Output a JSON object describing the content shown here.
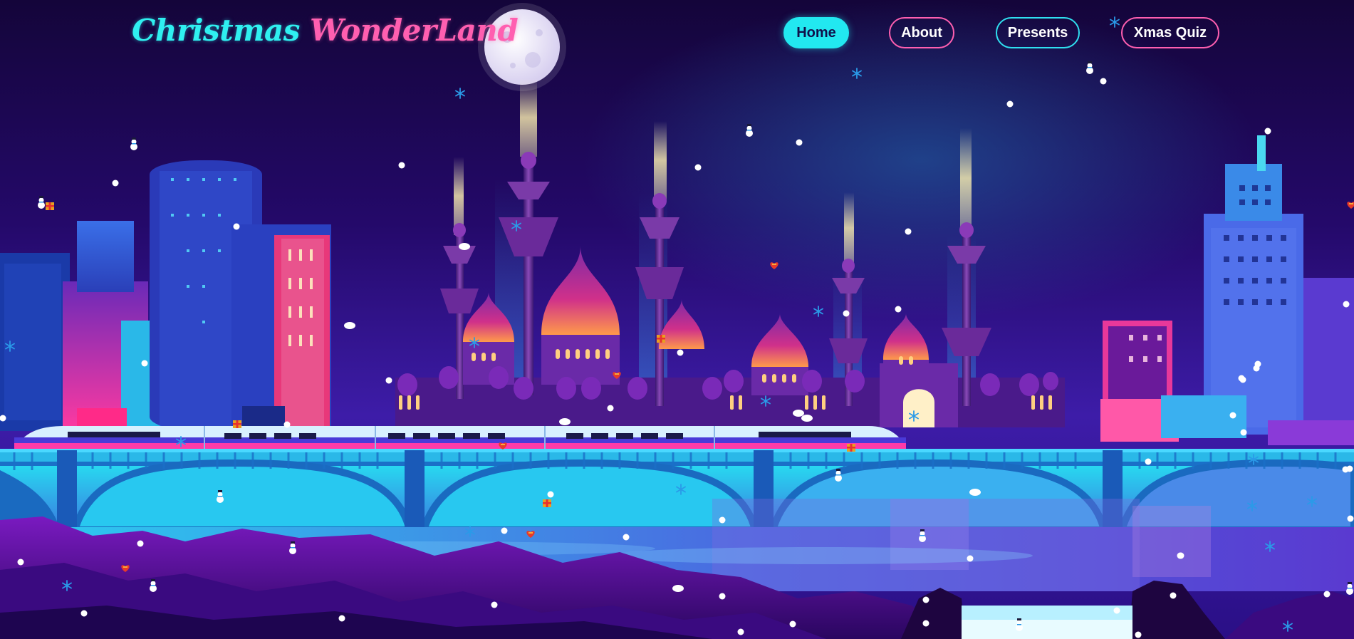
{
  "site": {
    "logo_part1": "Christmas",
    "logo_part2": "WonderLand"
  },
  "nav": {
    "home": "Home",
    "about": "About",
    "presents": "Presents",
    "quiz": "Xmas Quiz"
  },
  "colors": {
    "accent_cyan": "#22e8f0",
    "accent_pink": "#ff5fb0",
    "sky_dark": "#17063d",
    "sky_mid": "#3a1a8a"
  },
  "icons": [
    "moon-icon",
    "snowflake-icon",
    "snowman-icon",
    "gift-icon",
    "heart-icon",
    "snow-dot"
  ]
}
